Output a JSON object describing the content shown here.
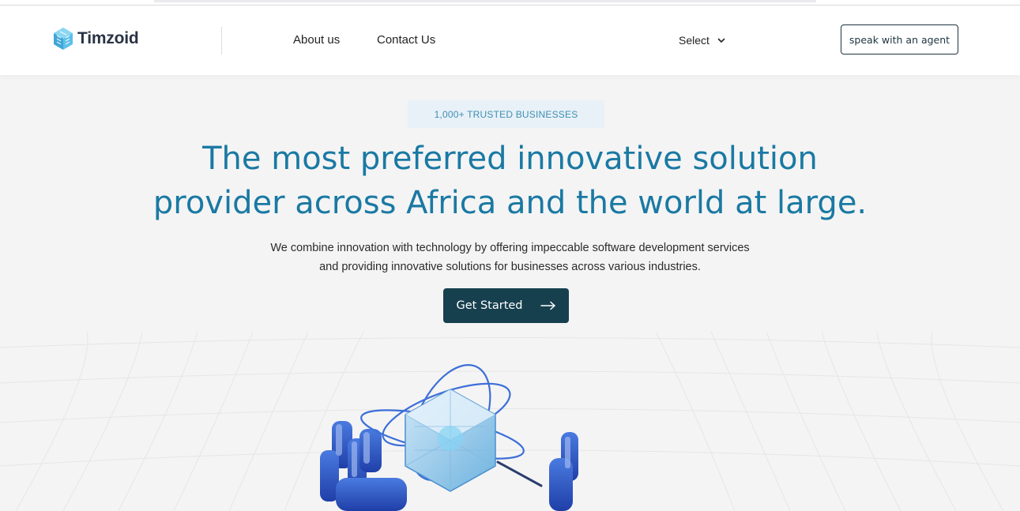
{
  "brand": {
    "name": "Timzoid",
    "logo_icon": "hexagon-cube-logo",
    "accent": "#1a79a3",
    "dark": "#17404f"
  },
  "nav": {
    "about_label": "About us",
    "contact_label": "Contact Us",
    "select_label": "Select",
    "agent_label": "speak with an agent"
  },
  "hero": {
    "badge": "1,000+ TRUSTED BUSINESSES",
    "headline_line1": "The most preferred innovative solution",
    "headline_line2": "provider across Africa and the world at large.",
    "sub_line1": "We combine innovation with technology by offering impeccable software development services",
    "sub_line2": "and providing innovative solutions for businesses across various industries.",
    "cta_label": "Get Started",
    "cta_icon": "arrow-right-icon"
  }
}
